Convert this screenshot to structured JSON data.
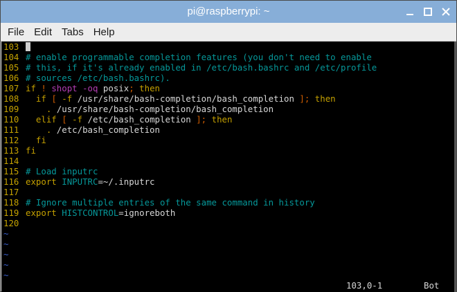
{
  "window": {
    "title": "pi@raspberrypi: ~"
  },
  "menu": [
    "File",
    "Edit",
    "Tabs",
    "Help"
  ],
  "colors": {
    "titlebar": "#87aed8",
    "line_number": "#c5a200",
    "comment": "#06989a",
    "keyword": "#c4a000",
    "tilde": "#3a5fcd",
    "background": "#000000"
  },
  "lines": [
    {
      "n": "103",
      "cursor": true,
      "segs": []
    },
    {
      "n": "104",
      "segs": [
        {
          "c": "t-comment",
          "t": "# enable programmable completion features (you don't need to enable"
        }
      ]
    },
    {
      "n": "105",
      "segs": [
        {
          "c": "t-comment",
          "t": "# this, if it's already enabled in /etc/bash.bashrc and /etc/profile"
        }
      ]
    },
    {
      "n": "106",
      "segs": [
        {
          "c": "t-comment",
          "t": "# sources /etc/bash.bashrc)."
        }
      ]
    },
    {
      "n": "107",
      "segs": [
        {
          "c": "t-keyword",
          "t": "if"
        },
        {
          "c": "t-normal",
          "t": " "
        },
        {
          "c": "t-orange",
          "t": "!"
        },
        {
          "c": "t-normal",
          "t": " "
        },
        {
          "c": "t-purple",
          "t": "shopt -oq"
        },
        {
          "c": "t-normal",
          "t": " posix"
        },
        {
          "c": "t-orange",
          "t": ";"
        },
        {
          "c": "t-normal",
          "t": " "
        },
        {
          "c": "t-keyword",
          "t": "then"
        }
      ]
    },
    {
      "n": "108",
      "segs": [
        {
          "c": "t-normal",
          "t": "  "
        },
        {
          "c": "t-keyword",
          "t": "if"
        },
        {
          "c": "t-normal",
          "t": " "
        },
        {
          "c": "t-orange",
          "t": "["
        },
        {
          "c": "t-normal",
          "t": " "
        },
        {
          "c": "t-keyword",
          "t": "-f"
        },
        {
          "c": "t-normal",
          "t": " /usr/share/bash-completion/bash_completion "
        },
        {
          "c": "t-orange",
          "t": "];"
        },
        {
          "c": "t-normal",
          "t": " "
        },
        {
          "c": "t-keyword",
          "t": "then"
        }
      ]
    },
    {
      "n": "109",
      "segs": [
        {
          "c": "t-normal",
          "t": "    "
        },
        {
          "c": "t-keyword",
          "t": "."
        },
        {
          "c": "t-normal",
          "t": " /usr/share/bash-completion/bash_completion"
        }
      ]
    },
    {
      "n": "110",
      "segs": [
        {
          "c": "t-normal",
          "t": "  "
        },
        {
          "c": "t-keyword",
          "t": "elif"
        },
        {
          "c": "t-normal",
          "t": " "
        },
        {
          "c": "t-orange",
          "t": "["
        },
        {
          "c": "t-normal",
          "t": " "
        },
        {
          "c": "t-keyword",
          "t": "-f"
        },
        {
          "c": "t-normal",
          "t": " /etc/bash_completion "
        },
        {
          "c": "t-orange",
          "t": "];"
        },
        {
          "c": "t-normal",
          "t": " "
        },
        {
          "c": "t-keyword",
          "t": "then"
        }
      ]
    },
    {
      "n": "111",
      "segs": [
        {
          "c": "t-normal",
          "t": "    "
        },
        {
          "c": "t-keyword",
          "t": "."
        },
        {
          "c": "t-normal",
          "t": " /etc/bash_completion"
        }
      ]
    },
    {
      "n": "112",
      "segs": [
        {
          "c": "t-normal",
          "t": "  "
        },
        {
          "c": "t-keyword",
          "t": "fi"
        }
      ]
    },
    {
      "n": "113",
      "segs": [
        {
          "c": "t-keyword",
          "t": "fi"
        }
      ]
    },
    {
      "n": "114",
      "segs": []
    },
    {
      "n": "115",
      "segs": [
        {
          "c": "t-comment",
          "t": "# Load inputrc"
        }
      ]
    },
    {
      "n": "116",
      "segs": [
        {
          "c": "t-keyword",
          "t": "export"
        },
        {
          "c": "t-normal",
          "t": " "
        },
        {
          "c": "t-var",
          "t": "INPUTRC"
        },
        {
          "c": "t-normal",
          "t": "=~/.inputrc"
        }
      ]
    },
    {
      "n": "117",
      "segs": []
    },
    {
      "n": "118",
      "segs": [
        {
          "c": "t-comment",
          "t": "# Ignore multiple entries of the same command in history"
        }
      ]
    },
    {
      "n": "119",
      "segs": [
        {
          "c": "t-keyword",
          "t": "export"
        },
        {
          "c": "t-normal",
          "t": " "
        },
        {
          "c": "t-var",
          "t": "HISTCONTROL"
        },
        {
          "c": "t-normal",
          "t": "=ignoreboth"
        }
      ]
    },
    {
      "n": "120",
      "segs": []
    }
  ],
  "tildes": [
    "~",
    "~",
    "~",
    "~",
    "~"
  ],
  "status": {
    "position": "103,0-1",
    "percent": "Bot"
  }
}
